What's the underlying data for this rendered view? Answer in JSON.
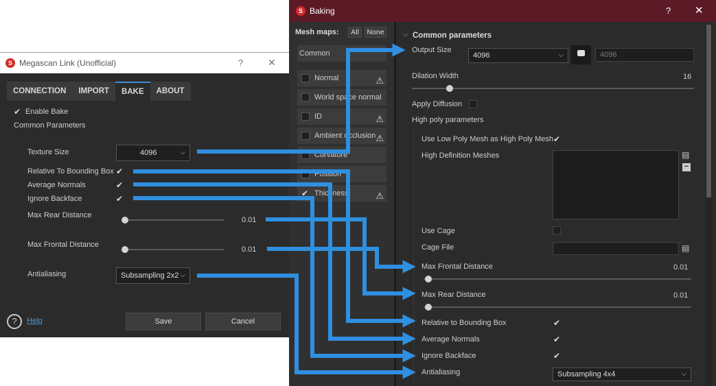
{
  "megascan": {
    "title": "Megascan Link (Unofficial)",
    "help_glyph": "?",
    "close_glyph": "✕",
    "tabs": [
      "CONNECTION",
      "IMPORT",
      "BAKE",
      "ABOUT"
    ],
    "enable_bake_label": "Enable Bake",
    "common_params_label": "Common Parameters",
    "texture_size_label": "Texture Size",
    "texture_size_value": "4096",
    "relative_bbox_label": "Relative To Bounding Box",
    "avg_normals_label": "Average Normals",
    "ignore_backface_label": "Ignore Backface",
    "max_rear_label": "Max Rear Distance",
    "max_rear_value": "0.01",
    "max_frontal_label": "Max Frontal Distance",
    "max_frontal_value": "0.01",
    "antialiasing_label": "Antialiasing",
    "antialiasing_value": "Subsampling 2x2",
    "help_link": "Help",
    "save_label": "Save",
    "cancel_label": "Cancel"
  },
  "baking": {
    "title": "Baking",
    "help_glyph": "?",
    "close_glyph": "✕",
    "mesh_maps_label": "Mesh maps:",
    "all_label": "All",
    "none_label": "None",
    "common_label": "Common",
    "maps": [
      {
        "label": "Normal",
        "warn": true,
        "checked": false
      },
      {
        "label": "World space normal",
        "warn": false,
        "checked": false
      },
      {
        "label": "ID",
        "warn": true,
        "checked": false
      },
      {
        "label": "Ambient occlusion",
        "warn": true,
        "checked": false
      },
      {
        "label": "Curvature",
        "warn": false,
        "checked": false
      },
      {
        "label": "Position",
        "warn": false,
        "checked": false
      },
      {
        "label": "Thickness",
        "warn": true,
        "checked": true
      }
    ],
    "section_title": "Common parameters",
    "output_size_label": "Output Size",
    "output_size_value": "4096",
    "output_size_locked_value": "4096",
    "dilation_label": "Dilation Width",
    "dilation_value": "16",
    "apply_diffusion_label": "Apply Diffusion",
    "high_poly_label": "High poly parameters",
    "use_low_poly_label": "Use Low Poly Mesh as High Poly Mesh",
    "high_def_meshes_label": "High Definition Meshes",
    "use_cage_label": "Use Cage",
    "cage_file_label": "Cage File",
    "max_frontal_label": "Max Frontal Distance",
    "max_frontal_value": "0.01",
    "max_rear_label": "Max Rear Distance",
    "max_rear_value": "0.01",
    "relative_bbox_label": "Relative to Bounding Box",
    "avg_normals_label": "Average Normals",
    "ignore_backface_label": "Ignore Backface",
    "antialiasing_label": "Antialiasing",
    "antialiasing_value": "Subsampling 4x4"
  },
  "colors": {
    "arrow": "#2f8fe0",
    "baking_titlebar": "#5c1a26",
    "tab_accent": "#3d8fd6"
  }
}
